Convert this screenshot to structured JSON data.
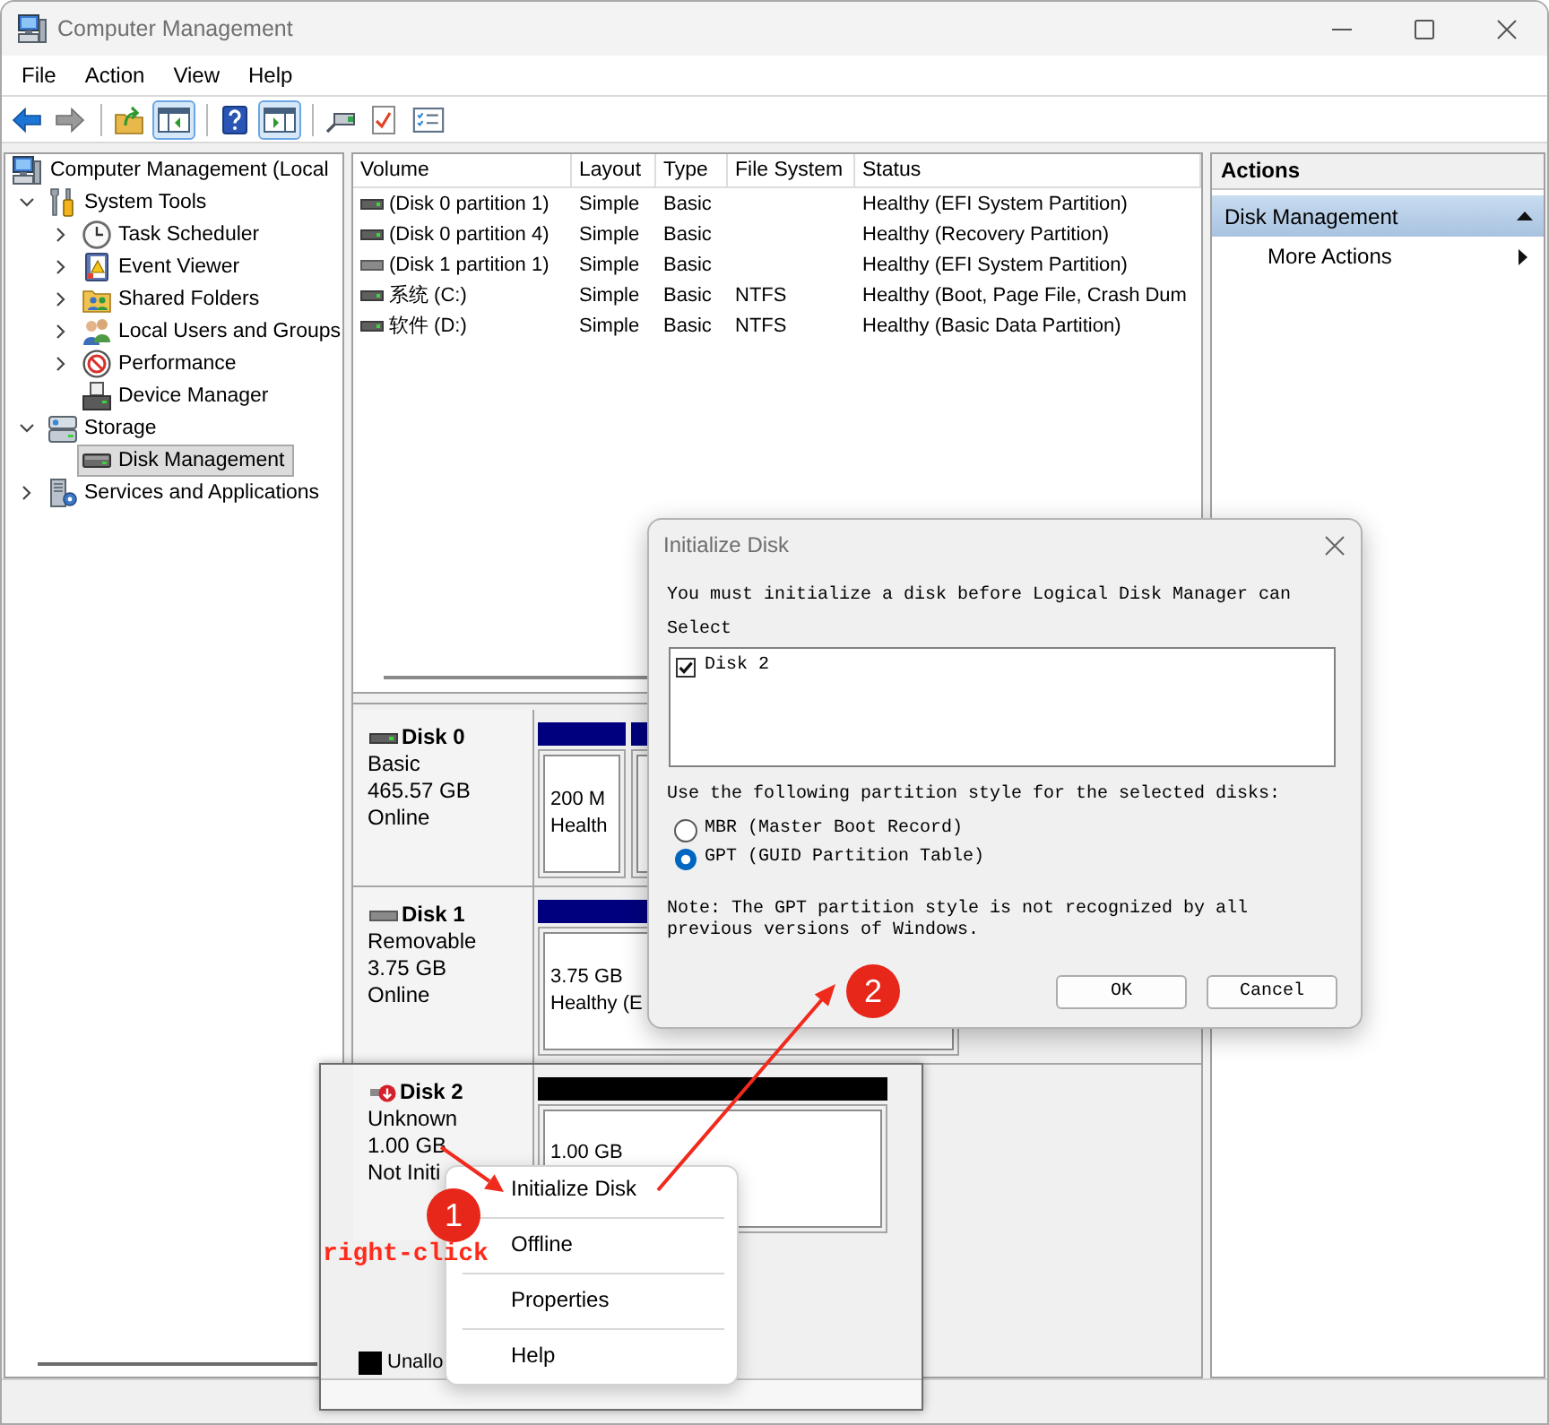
{
  "window": {
    "title": "Computer Management"
  },
  "menu": [
    {
      "label": "File"
    },
    {
      "label": "Action"
    },
    {
      "label": "View"
    },
    {
      "label": "Help"
    }
  ],
  "toolbar": [
    {
      "kind": "back",
      "disabled": false,
      "pressed": false
    },
    {
      "kind": "forward",
      "disabled": true,
      "pressed": false
    },
    {
      "kind": "separator"
    },
    {
      "kind": "up",
      "disabled": false,
      "pressed": false
    },
    {
      "kind": "tree",
      "disabled": false,
      "pressed": true
    },
    {
      "kind": "separator"
    },
    {
      "kind": "help",
      "disabled": false,
      "pressed": false
    },
    {
      "kind": "pane",
      "disabled": false,
      "pressed": true
    },
    {
      "kind": "separator"
    },
    {
      "kind": "connect",
      "disabled": false,
      "pressed": false
    },
    {
      "kind": "check",
      "disabled": false,
      "pressed": false
    },
    {
      "kind": "list",
      "disabled": false,
      "pressed": false
    }
  ],
  "tree": {
    "label": "Computer Management (Local",
    "kind": "computer",
    "selected": false,
    "children": [
      {
        "label": "System Tools",
        "kind": "tools",
        "expanded": true,
        "selected": false,
        "children": [
          {
            "label": "Task Scheduler",
            "kind": "scheduler",
            "expanded": false,
            "selected": false
          },
          {
            "label": "Event Viewer",
            "kind": "viewer",
            "expanded": false,
            "selected": false
          },
          {
            "label": "Shared Folders",
            "kind": "shares",
            "expanded": false,
            "selected": false
          },
          {
            "label": "Local Users and Groups",
            "kind": "users",
            "expanded": false,
            "selected": false
          },
          {
            "label": "Performance",
            "kind": "performance",
            "expanded": false,
            "selected": false
          },
          {
            "label": "Device Manager",
            "kind": "devices",
            "selected": false
          }
        ]
      },
      {
        "label": "Storage",
        "kind": "storage",
        "expanded": true,
        "selected": false,
        "children": [
          {
            "label": "Disk Management",
            "kind": "disks",
            "selected": true
          }
        ]
      },
      {
        "label": "Services and Applications",
        "kind": "services",
        "expanded": false,
        "selected": false
      }
    ]
  },
  "volumes": {
    "columns": [
      "Volume",
      "Layout",
      "Type",
      "File System",
      "Status"
    ],
    "rows": [
      {
        "kind": "fixed",
        "volume": "(Disk 0 partition 1)",
        "layout": "Simple",
        "type": "Basic",
        "status": "Healthy (EFI System Partition)"
      },
      {
        "kind": "fixed",
        "volume": "(Disk 0 partition 4)",
        "layout": "Simple",
        "type": "Basic",
        "status": "Healthy (Recovery Partition)"
      },
      {
        "kind": "removable",
        "volume": "(Disk 1 partition 1)",
        "layout": "Simple",
        "type": "Basic",
        "status": "Healthy (EFI System Partition)"
      },
      {
        "kind": "fixed",
        "volume": "系统 (C:)",
        "layout": "Simple",
        "type": "Basic",
        "file_system": "NTFS",
        "status": "Healthy (Boot, Page File, Crash Dum"
      },
      {
        "kind": "fixed",
        "volume": "软件 (D:)",
        "layout": "Simple",
        "type": "Basic",
        "file_system": "NTFS",
        "status": "Healthy (Basic Data Partition)"
      }
    ]
  },
  "disk_view": {
    "disks": [
      {
        "kind": "fixed",
        "name": "Disk 0",
        "details": [
          "Basic",
          "465.57 GB",
          "Online"
        ],
        "partitions": [
          {
            "kind": "primary",
            "lines": [
              "200 M",
              "Health"
            ]
          },
          {
            "kind": "primary"
          }
        ]
      },
      {
        "kind": "removable",
        "name": "Disk 1",
        "details": [
          "Removable",
          "3.75 GB",
          "Online"
        ],
        "partitions": [
          {
            "kind": "primary",
            "lines": [
              "3.75 GB",
              "Healthy (E"
            ]
          }
        ]
      }
    ]
  },
  "actions": {
    "title": "Actions",
    "sections": [
      {
        "label": "Disk Management",
        "expanded": true,
        "items": [
          {
            "label": "More Actions",
            "submenu": true
          }
        ]
      }
    ]
  },
  "inset": {
    "disk": {
      "kind": "uninitialized",
      "name": "Disk 2",
      "details": [
        "Unknown",
        "1.00 GB",
        "Not Initi"
      ],
      "partitions": [
        {
          "kind": "unallocated",
          "lines": [
            "1.00 GB"
          ]
        }
      ]
    },
    "legend": [
      {
        "label": "Unallo",
        "color": "#000000"
      }
    ]
  },
  "context_menu": {
    "items": [
      {
        "label": "Initialize Disk"
      },
      {
        "label": "Offline"
      },
      {
        "label": "Properties"
      },
      {
        "label": "Help"
      }
    ]
  },
  "dialog": {
    "title": "Initialize Disk",
    "message": "You must initialize a disk before Logical Disk Manager can",
    "list_label": "Select",
    "disks": [
      {
        "label": "Disk 2",
        "checked": true
      }
    ],
    "style_prompt": "Use the following partition style for the selected disks:",
    "styles": [
      {
        "label": "MBR (Master Boot Record)",
        "selected": false
      },
      {
        "label": "GPT (GUID Partition Table)",
        "selected": true
      }
    ],
    "note": "Note: The GPT partition style is not recognized by all previous versions of Windows.",
    "buttons": [
      {
        "label": "OK"
      },
      {
        "label": "Cancel"
      }
    ]
  },
  "annotations": {
    "steps": [
      {
        "number": "1"
      },
      {
        "number": "2"
      }
    ],
    "label": "right-click"
  }
}
